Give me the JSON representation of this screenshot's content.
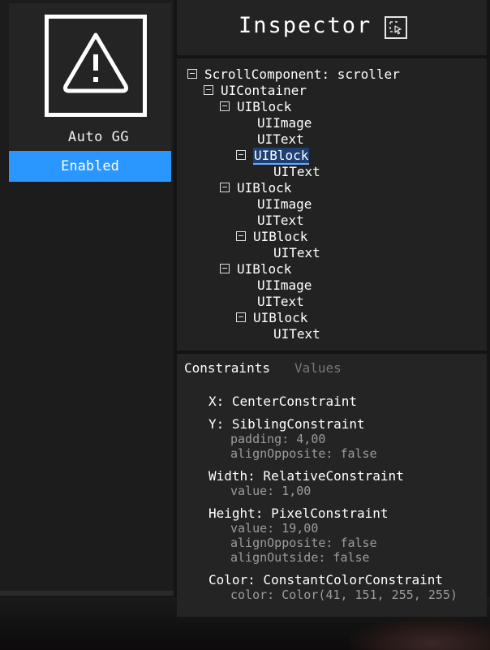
{
  "module": {
    "name": "Auto GG",
    "toggle_label": "Enabled",
    "icon": "warning-triangle-icon",
    "accent_color": "#2997ff"
  },
  "inspector": {
    "title": "Inspector",
    "picker_icon": "element-picker-icon"
  },
  "tree": {
    "rows": [
      {
        "label": "ScrollComponent: scroller",
        "expandable": true
      },
      {
        "label": "UIContainer",
        "expandable": true
      },
      {
        "label": "UIBlock",
        "expandable": true
      },
      {
        "label": "UIImage",
        "expandable": false
      },
      {
        "label": "UIText",
        "expandable": false
      },
      {
        "label": "UIBlock",
        "expandable": true,
        "selected": true
      },
      {
        "label": "UIText",
        "expandable": false
      },
      {
        "label": "UIBlock",
        "expandable": true
      },
      {
        "label": "UIImage",
        "expandable": false
      },
      {
        "label": "UIText",
        "expandable": false
      },
      {
        "label": "UIBlock",
        "expandable": true
      },
      {
        "label": "UIText",
        "expandable": false
      },
      {
        "label": "UIBlock",
        "expandable": true
      },
      {
        "label": "UIImage",
        "expandable": false
      },
      {
        "label": "UIText",
        "expandable": false
      },
      {
        "label": "UIBlock",
        "expandable": true
      },
      {
        "label": "UIText",
        "expandable": false
      }
    ]
  },
  "props": {
    "tabs": {
      "constraints": "Constraints",
      "values": "Values"
    },
    "x": "X: CenterConstraint",
    "y": "Y: SiblingConstraint",
    "y_padding": "padding: 4,00",
    "y_align_opposite": "alignOpposite: false",
    "width": "Width: RelativeConstraint",
    "width_value": "value: 1,00",
    "height": "Height: PixelConstraint",
    "height_value": "value: 19,00",
    "height_align_opposite": "alignOpposite: false",
    "height_align_outside": "alignOutside: false",
    "color": "Color: ConstantColorConstraint",
    "color_value": "color: Color(41, 151, 255, 255)"
  }
}
